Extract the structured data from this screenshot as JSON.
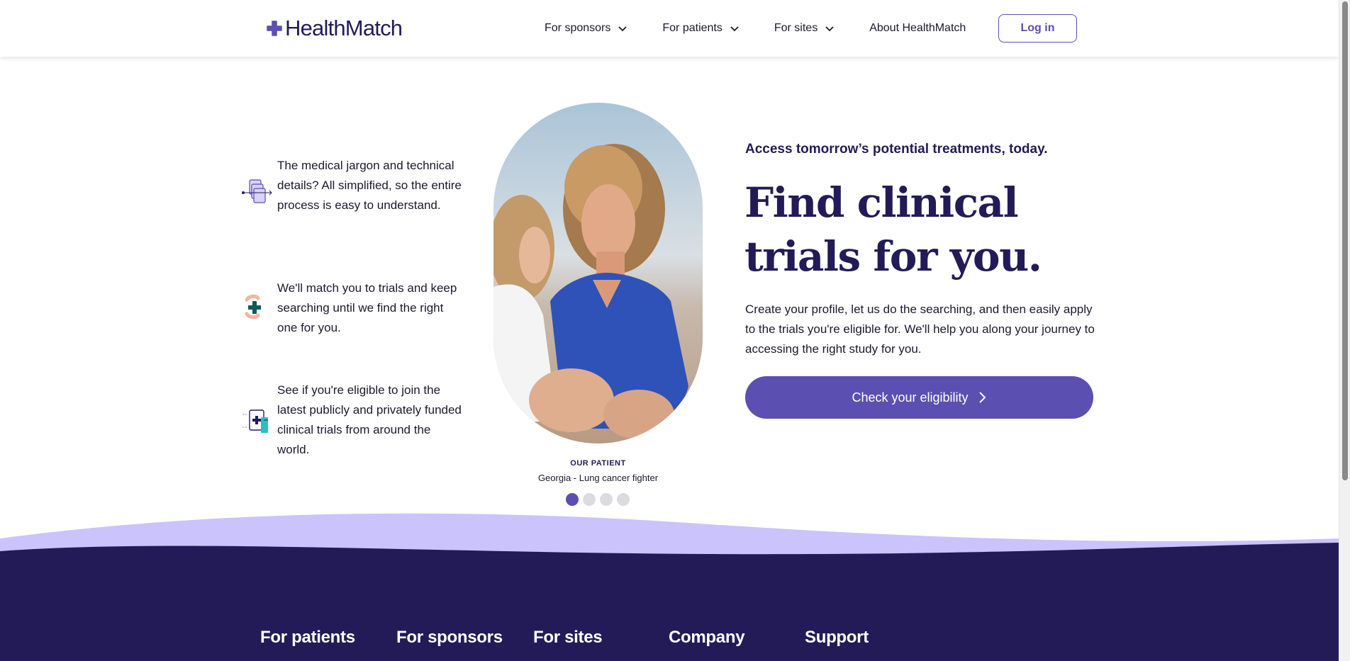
{
  "header": {
    "logo_text": "HealthMatch",
    "nav": [
      {
        "label": "For sponsors",
        "has_dropdown": true
      },
      {
        "label": "For patients",
        "has_dropdown": true
      },
      {
        "label": "For sites",
        "has_dropdown": true
      },
      {
        "label": "About HealthMatch",
        "has_dropdown": false
      }
    ],
    "login_label": "Log in"
  },
  "features": [
    {
      "icon": "documents-icon",
      "text": "The medical jargon and technical details? All simplified, so the entire process is easy to understand."
    },
    {
      "icon": "hands-cross-icon",
      "text": "We'll match you to trials and keep searching until we find the right one for you."
    },
    {
      "icon": "eligibility-document-icon",
      "text": "See if you're eligible to join the latest publicly and privately funded clinical trials from around the world."
    }
  ],
  "patient": {
    "tag": "OUR PATIENT",
    "name": "Georgia - Lung cancer fighter",
    "slide_count": 4,
    "active_slide": 1
  },
  "hero": {
    "kicker": "Access tomorrow’s potential treatments, today.",
    "headline": "Find clinical trials for you.",
    "lead": "Create your profile, let us do the searching, and then easily apply to the trials you're eligible for. We'll help you along your journey to accessing the right study for you.",
    "cta_label": "Check your eligibility"
  },
  "footer": {
    "columns": [
      "For patients",
      "For sponsors",
      "For sites",
      "Company",
      "Support"
    ]
  },
  "colors": {
    "brand_dark": "#231b58",
    "brand_purple": "#5b4fb1",
    "wave_light": "#cbc3fb",
    "footer_bg": "#231b58"
  }
}
